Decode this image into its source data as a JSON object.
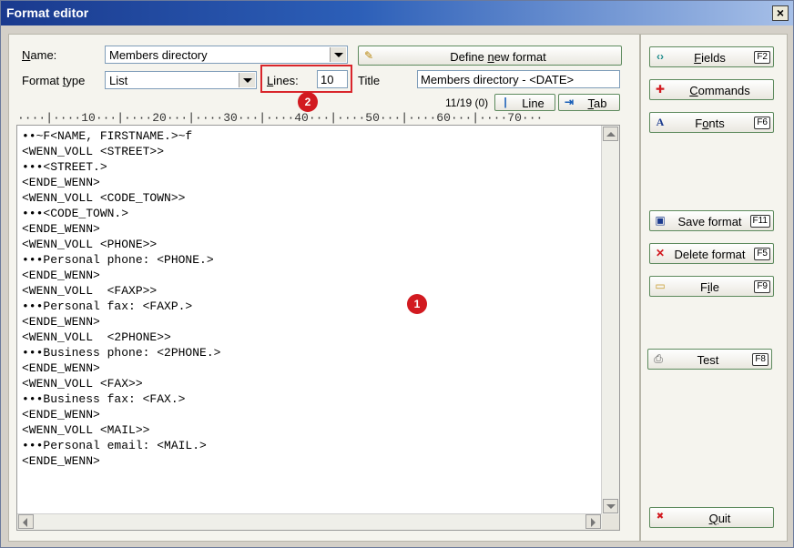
{
  "window": {
    "title": "Format editor",
    "close_label": "×"
  },
  "form": {
    "name_label_pre": "",
    "name_label_u": "N",
    "name_label_post": "ame:",
    "name_value": "Members directory",
    "formattype_label_pre": "Format ",
    "formattype_label_u": "t",
    "formattype_label_post": "ype",
    "formattype_value": "List",
    "lines_label_u": "L",
    "lines_label_post": "ines:",
    "lines_value": "10",
    "title_label": "Title",
    "title_value": "Members directory - <DATE>",
    "define_label_pre": "Define ",
    "define_label_u": "n",
    "define_label_post": "ew format",
    "counter": "11/19 (0)",
    "line_button": "Line",
    "tab_button_u": "T",
    "tab_button_post": "ab"
  },
  "ruler": "····|····10···|····20···|····30···|····40···|····50···|····60···|····70···",
  "editor_lines": [
    "••~F<NAME, FIRSTNAME.>~f",
    "<WENN_VOLL <STREET>>",
    "•••<STREET.>",
    "<ENDE_WENN>",
    "<WENN_VOLL <CODE_TOWN>>",
    "•••<CODE_TOWN.>",
    "<ENDE_WENN>",
    "<WENN_VOLL <PHONE>>",
    "•••Personal phone: <PHONE.>",
    "<ENDE_WENN>",
    "<WENN_VOLL  <FAXP>>",
    "•••Personal fax: <FAXP.>",
    "<ENDE_WENN>",
    "<WENN_VOLL  <2PHONE>>",
    "•••Business phone: <2PHONE.>",
    "<ENDE_WENN>",
    "<WENN_VOLL <FAX>>",
    "•••Business fax: <FAX.>",
    "<ENDE_WENN>",
    "<WENN_VOLL <MAIL>>",
    "•••Personal email: <MAIL.>",
    "<ENDE_WENN>"
  ],
  "sidebar": {
    "fields": {
      "u": "F",
      "post": "ields",
      "key": "F2",
      "icon": "‹›"
    },
    "commands": {
      "u": "C",
      "post": "ommands",
      "icon": "✚"
    },
    "fonts": {
      "pre": "F",
      "u": "o",
      "post": "nts",
      "key": "F6",
      "icon": "A"
    },
    "save": {
      "label": "Save format",
      "key": "F11",
      "icon": "▣"
    },
    "delete": {
      "label": "Delete format",
      "key": "F5",
      "icon": "✕"
    },
    "file": {
      "pre": "F",
      "u": "i",
      "post": "le",
      "key": "F9",
      "icon": "▭"
    },
    "test": {
      "label": "Test",
      "key": "F8",
      "icon": "⎙"
    },
    "quit": {
      "u": "Q",
      "post": "uit",
      "icon": "✖"
    }
  },
  "annotations": {
    "badge1": "1",
    "badge2": "2"
  },
  "colors": {
    "title_start": "#1a3a8e",
    "title_end": "#a7c0e8",
    "highlight": "#d9252b",
    "badge": "#d21a20",
    "button_border": "#5d8a5d"
  }
}
